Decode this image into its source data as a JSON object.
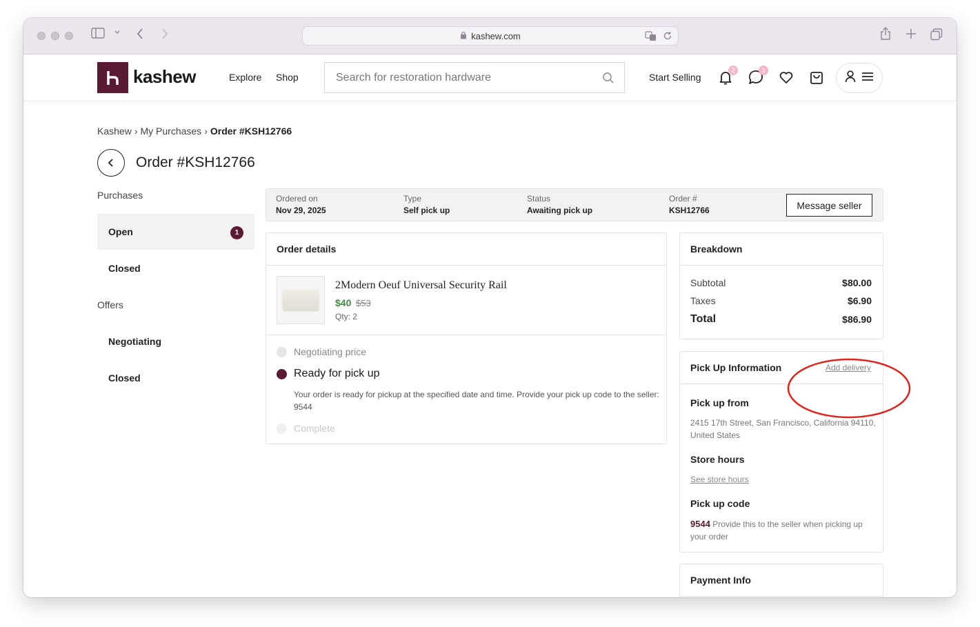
{
  "browser": {
    "url": "kashew.com"
  },
  "header": {
    "logo_text": "kashew",
    "nav": [
      "Explore",
      "Shop"
    ],
    "search_placeholder": "Search for restoration hardware",
    "start_selling": "Start Selling",
    "notifications_count": "2",
    "messages_count": "1"
  },
  "breadcrumb": {
    "items": [
      "Kashew",
      "My Purchases"
    ],
    "current": "Order #KSH12766"
  },
  "page_title": "Order #KSH12766",
  "sidebar": {
    "purchases_heading": "Purchases",
    "purchases": [
      {
        "label": "Open",
        "count": "1"
      },
      {
        "label": "Closed"
      }
    ],
    "offers_heading": "Offers",
    "offers": [
      {
        "label": "Negotiating"
      },
      {
        "label": "Closed"
      }
    ]
  },
  "summary": {
    "ordered_on_label": "Ordered on",
    "ordered_on": "Nov 29, 2025",
    "type_label": "Type",
    "type": "Self pick up",
    "status_label": "Status",
    "status": "Awaiting pick up",
    "order_no_label": "Order #",
    "order_no": "KSH12766",
    "message_button": "Message seller"
  },
  "order_details": {
    "title": "Order details",
    "product": {
      "name": "2Modern Oeuf Universal Security Rail",
      "price": "$40",
      "original_price": "$53",
      "qty": "Qty: 2"
    },
    "steps": [
      {
        "label": "Negotiating price",
        "state": "past"
      },
      {
        "label": "Ready for pick up",
        "state": "current"
      },
      {
        "label": "Complete",
        "state": "future"
      }
    ],
    "current_step_description": "Your order is ready for pickup at the specified date and time. Provide your pick up code to the seller: 9544"
  },
  "breakdown": {
    "title": "Breakdown",
    "subtotal_label": "Subtotal",
    "subtotal": "$80.00",
    "taxes_label": "Taxes",
    "taxes": "$6.90",
    "total_label": "Total",
    "total": "$86.90"
  },
  "pickup": {
    "title": "Pick Up Information",
    "add_delivery": "Add delivery",
    "from_label": "Pick up from",
    "address": "2415 17th Street, San Francisco, California 94110, United States",
    "hours_label": "Store hours",
    "hours_link": "See store hours",
    "code_label": "Pick up code",
    "code": "9544",
    "code_note": "Provide this to the seller when picking up your order"
  },
  "payment": {
    "title": "Payment Info"
  },
  "colors": {
    "brand": "#5a1a35",
    "sale_price": "#3b8c3b",
    "annotation": "#e0241c"
  }
}
